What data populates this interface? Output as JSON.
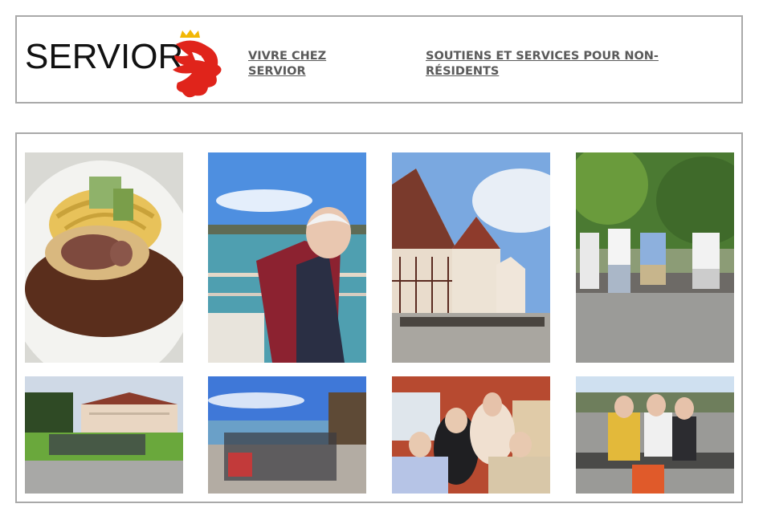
{
  "header": {
    "logo": {
      "text": "SERVIOR",
      "accent_color": "#e0241b",
      "crown_color": "#f2b705"
    },
    "nav": [
      {
        "label": "VIVRE CHEZ SERVIOR"
      },
      {
        "label": "SOUTIENS ET SERVICES POUR NON-RÉSIDENTS"
      }
    ]
  },
  "gallery": {
    "photos": [
      {
        "subject": "plate-beef-wellington-pasta"
      },
      {
        "subject": "man-on-boat-deck-lake"
      },
      {
        "subject": "half-timbered-town-square"
      },
      {
        "subject": "group-sitting-on-bench-forest"
      },
      {
        "subject": "group-photo-palace-lawn"
      },
      {
        "subject": "group-lakeside-viewpoint"
      },
      {
        "subject": "group-indoor-restaurant"
      },
      {
        "subject": "group-bench-harbor"
      }
    ]
  }
}
